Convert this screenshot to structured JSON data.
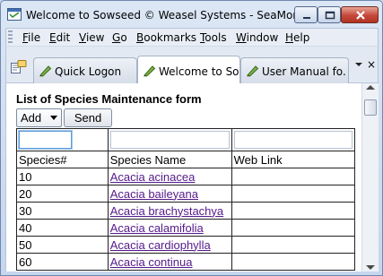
{
  "window": {
    "title": "Welcome to Sowseed © Weasel Systems - SeaMonkey",
    "app_icon": "seamonkey-icon"
  },
  "menubar": {
    "items": [
      "File",
      "Edit",
      "View",
      "Go",
      "Bookmarks",
      "Tools",
      "Window",
      "Help"
    ]
  },
  "tabs": [
    {
      "label": "Quick Logon",
      "icon": "bookmark-pencil-icon",
      "active": false
    },
    {
      "label": "Welcome to So...",
      "icon": "bookmark-pencil-icon",
      "active": true
    },
    {
      "label": "User Manual fo...",
      "icon": "bookmark-pencil-icon",
      "active": false
    }
  ],
  "tab_controls": {
    "list_icon": "chevron-down-icon",
    "close_label": "×"
  },
  "form": {
    "heading": "List of Species Maintenance form",
    "action_select_value": "Add",
    "send_label": "Send"
  },
  "table": {
    "headers": [
      "Species#",
      "Species Name",
      "Web Link"
    ],
    "rows": [
      {
        "num": "10",
        "name": "Acacia acinacea",
        "link": ""
      },
      {
        "num": "20",
        "name": "Acacia baileyana",
        "link": ""
      },
      {
        "num": "30",
        "name": "Acacia brachystachya",
        "link": ""
      },
      {
        "num": "40",
        "name": "Acacia calamifolia",
        "link": ""
      },
      {
        "num": "50",
        "name": "Acacia cardiophylla",
        "link": ""
      },
      {
        "num": "60",
        "name": "Acacia continua",
        "link": ""
      }
    ]
  },
  "colors": {
    "visited_link": "#551a8b",
    "focus_border": "#5d9bd8"
  }
}
